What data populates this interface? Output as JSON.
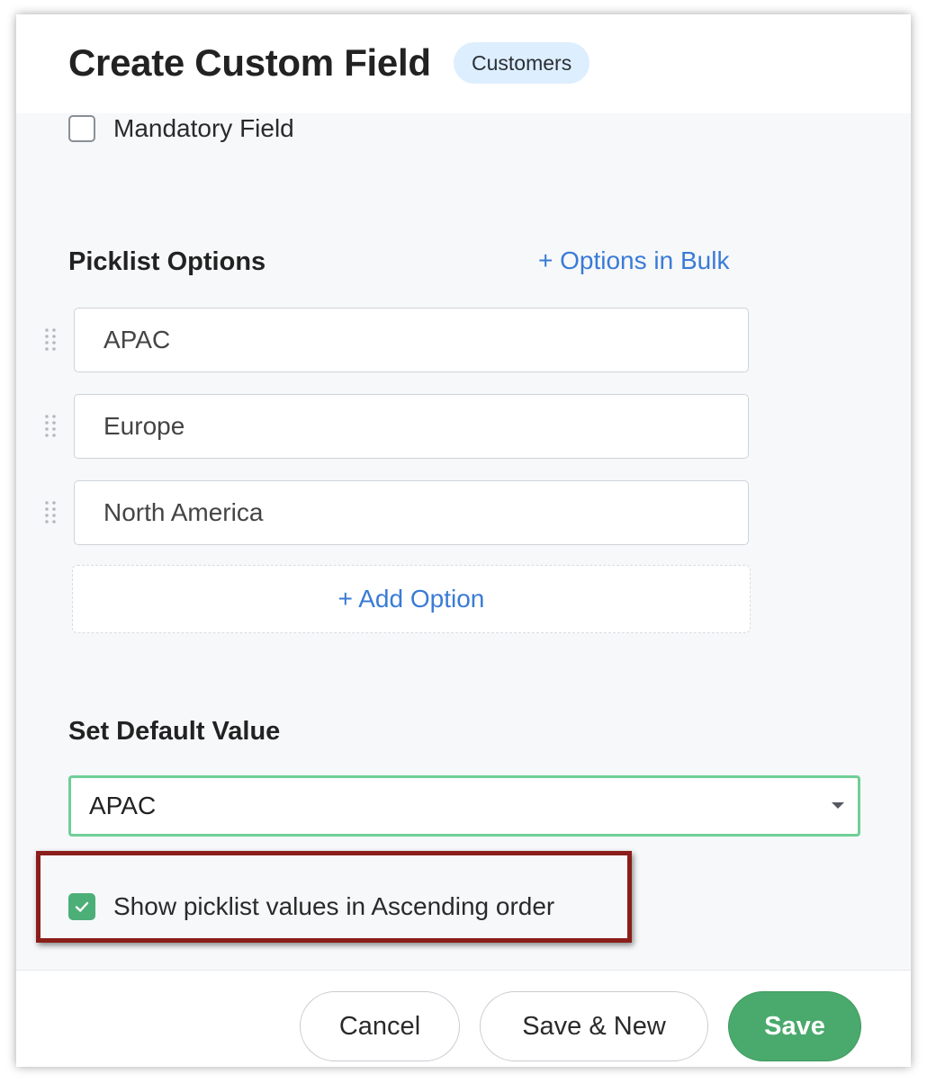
{
  "header": {
    "title": "Create Custom Field",
    "module_badge": "Customers"
  },
  "mandatory": {
    "label": "Mandatory Field",
    "checked": false
  },
  "picklist": {
    "section_title": "Picklist Options",
    "bulk_link": "+ Options in Bulk",
    "options": [
      "APAC",
      "Europe",
      "North America"
    ],
    "add_option_label": "+ Add Option"
  },
  "default_value": {
    "section_title": "Set Default Value",
    "selected": "APAC"
  },
  "ascending": {
    "label": "Show picklist values in Ascending order",
    "checked": true
  },
  "footer": {
    "cancel_label": "Cancel",
    "save_new_label": "Save & New",
    "save_label": "Save"
  },
  "colors": {
    "accent_link": "#3a7bd5",
    "primary_button": "#4aa96c",
    "select_border": "#6fcf97",
    "highlight_border": "#8b1e1b"
  },
  "icons": {
    "drag_handle": "drag-handle-icon",
    "dropdown": "chevron-down-icon",
    "check": "check-icon"
  }
}
